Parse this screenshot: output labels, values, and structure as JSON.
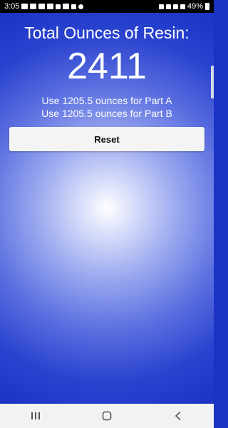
{
  "status_bar": {
    "time": "3:05",
    "battery": "49%"
  },
  "main": {
    "title": "Total Ounces of Resin:",
    "total": "2411",
    "part_a": "Use 1205.5 ounces for Part A",
    "part_b": "Use 1205.5 ounces for Part B",
    "reset_label": "Reset"
  },
  "nav": {
    "recents_icon": "recents-icon",
    "home_icon": "home-icon",
    "back_icon": "back-icon"
  },
  "colors": {
    "gradient_center": "#ffffff",
    "gradient_edge": "#1a33c4",
    "button_bg": "#f4f4f4"
  }
}
